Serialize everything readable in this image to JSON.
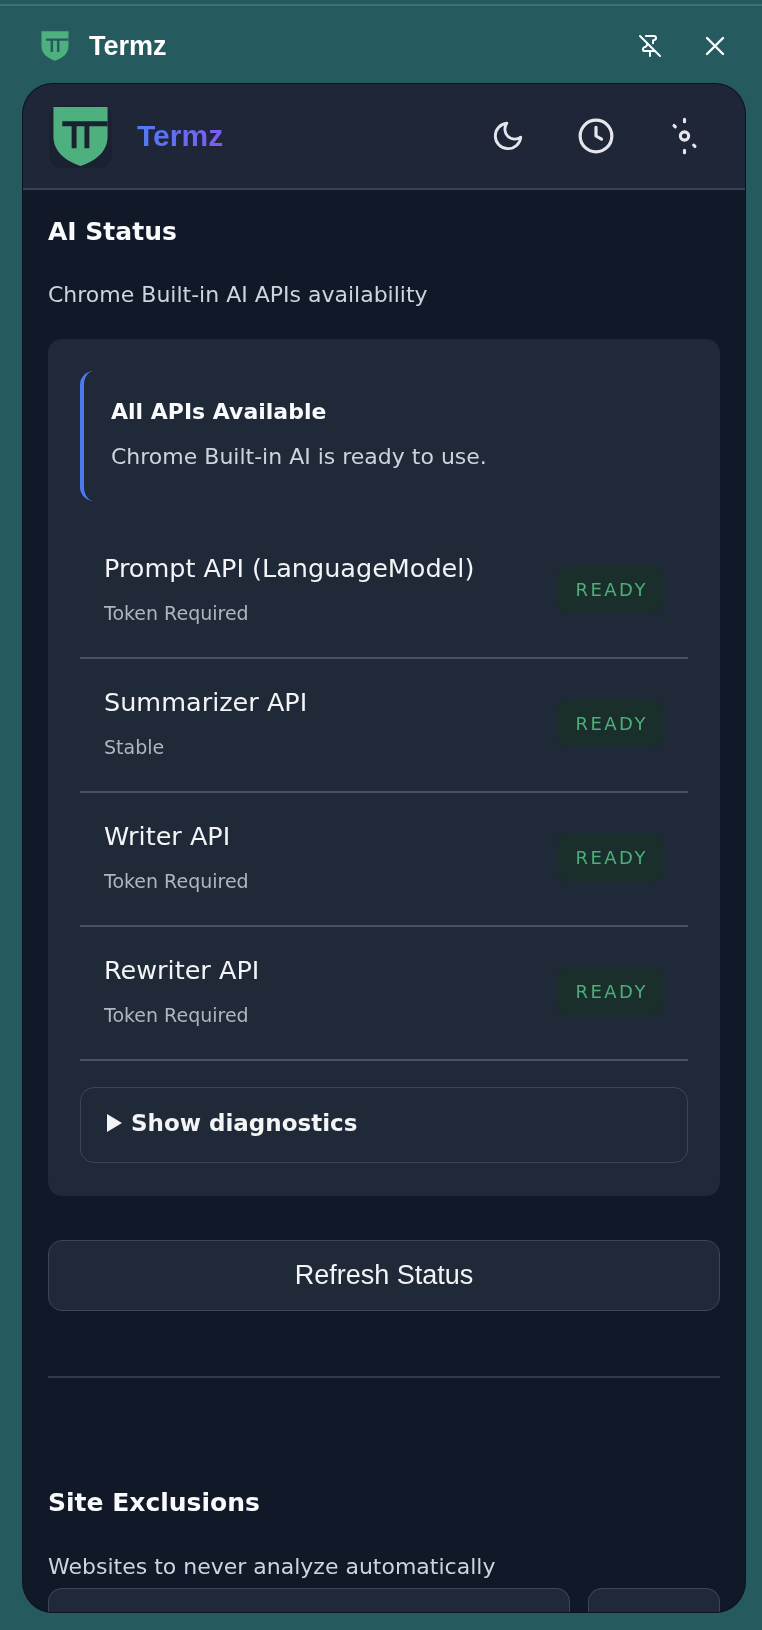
{
  "window": {
    "title": "Termz"
  },
  "header": {
    "brand": "Termz"
  },
  "ai_status": {
    "title": "AI Status",
    "description": "Chrome Built-in AI APIs availability",
    "alert": {
      "title": "All APIs Available",
      "message": "Chrome Built-in AI is ready to use."
    },
    "apis": [
      {
        "name": "Prompt API (LanguageModel)",
        "note": "Token Required",
        "status": "READY"
      },
      {
        "name": "Summarizer API",
        "note": "Stable",
        "status": "READY"
      },
      {
        "name": "Writer API",
        "note": "Token Required",
        "status": "READY"
      },
      {
        "name": "Rewriter API",
        "note": "Token Required",
        "status": "READY"
      }
    ],
    "diagnostics": {
      "label": "Show diagnostics",
      "expanded": false
    },
    "refresh_button": "Refresh Status"
  },
  "site_exclusions": {
    "title": "Site Exclusions",
    "description": "Websites to never analyze automatically"
  }
}
